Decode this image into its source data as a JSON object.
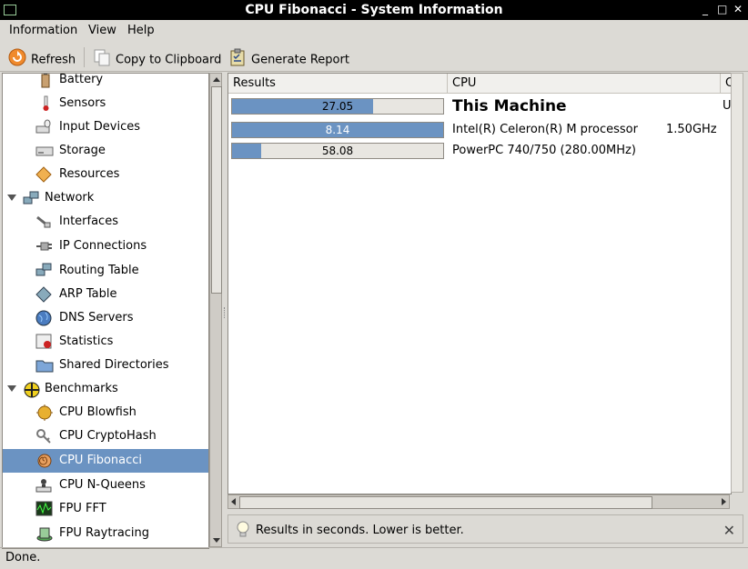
{
  "window": {
    "title": "CPU Fibonacci - System Information",
    "controls": [
      "_",
      "□",
      "✕"
    ]
  },
  "menu": [
    "Information",
    "View",
    "Help"
  ],
  "toolbar": {
    "refresh": "Refresh",
    "copy": "Copy to Clipboard",
    "report": "Generate Report"
  },
  "sidebar": [
    {
      "label": "Battery",
      "icon": "battery-icon",
      "level": 1
    },
    {
      "label": "Sensors",
      "icon": "thermometer-icon",
      "level": 1
    },
    {
      "label": "Input Devices",
      "icon": "keyboard-mouse-icon",
      "level": 1
    },
    {
      "label": "Storage",
      "icon": "hard-drive-icon",
      "level": 1
    },
    {
      "label": "Resources",
      "icon": "resources-icon",
      "level": 1
    },
    {
      "label": "Network",
      "icon": "network-icon",
      "level": 0,
      "expander": true
    },
    {
      "label": "Interfaces",
      "icon": "cable-icon",
      "level": 1
    },
    {
      "label": "IP Connections",
      "icon": "plug-icon",
      "level": 1
    },
    {
      "label": "Routing Table",
      "icon": "computers-icon",
      "level": 1
    },
    {
      "label": "ARP Table",
      "icon": "arp-icon",
      "level": 1
    },
    {
      "label": "DNS Servers",
      "icon": "globe-icon",
      "level": 1
    },
    {
      "label": "Statistics",
      "icon": "statistics-icon",
      "level": 1
    },
    {
      "label": "Shared Directories",
      "icon": "folder-icon",
      "level": 1
    },
    {
      "label": "Benchmarks",
      "icon": "benchmarks-icon",
      "level": 0,
      "expander": true
    },
    {
      "label": "CPU Blowfish",
      "icon": "blowfish-icon",
      "level": 1
    },
    {
      "label": "CPU CryptoHash",
      "icon": "keys-icon",
      "level": 1
    },
    {
      "label": "CPU Fibonacci",
      "icon": "shell-icon",
      "level": 1,
      "selected": true
    },
    {
      "label": "CPU N-Queens",
      "icon": "chess-icon",
      "level": 1
    },
    {
      "label": "FPU FFT",
      "icon": "fft-icon",
      "level": 1
    },
    {
      "label": "FPU Raytracing",
      "icon": "raytracing-icon",
      "level": 1
    }
  ],
  "results": {
    "columns": [
      "Results",
      "CPU",
      "C"
    ],
    "rows": [
      {
        "value": "27.05",
        "fraction": 0.67,
        "cpu": "This Machine",
        "freq": "U",
        "highlight": true
      },
      {
        "value": "8.14",
        "fraction": 1.0,
        "cpu": "Intel(R) Celeron(R) M processor",
        "freq": "1.50GHz",
        "highlight": false
      },
      {
        "value": "58.08",
        "fraction": 0.14,
        "cpu": "PowerPC 740/750 (280.00MHz)",
        "freq": "",
        "highlight": false
      }
    ]
  },
  "note": "Results in seconds. Lower is better.",
  "status": "Done.",
  "colors": {
    "selection": "#6b93c2",
    "bar_fill": "#6b93c2",
    "titlebar": "#000000"
  }
}
